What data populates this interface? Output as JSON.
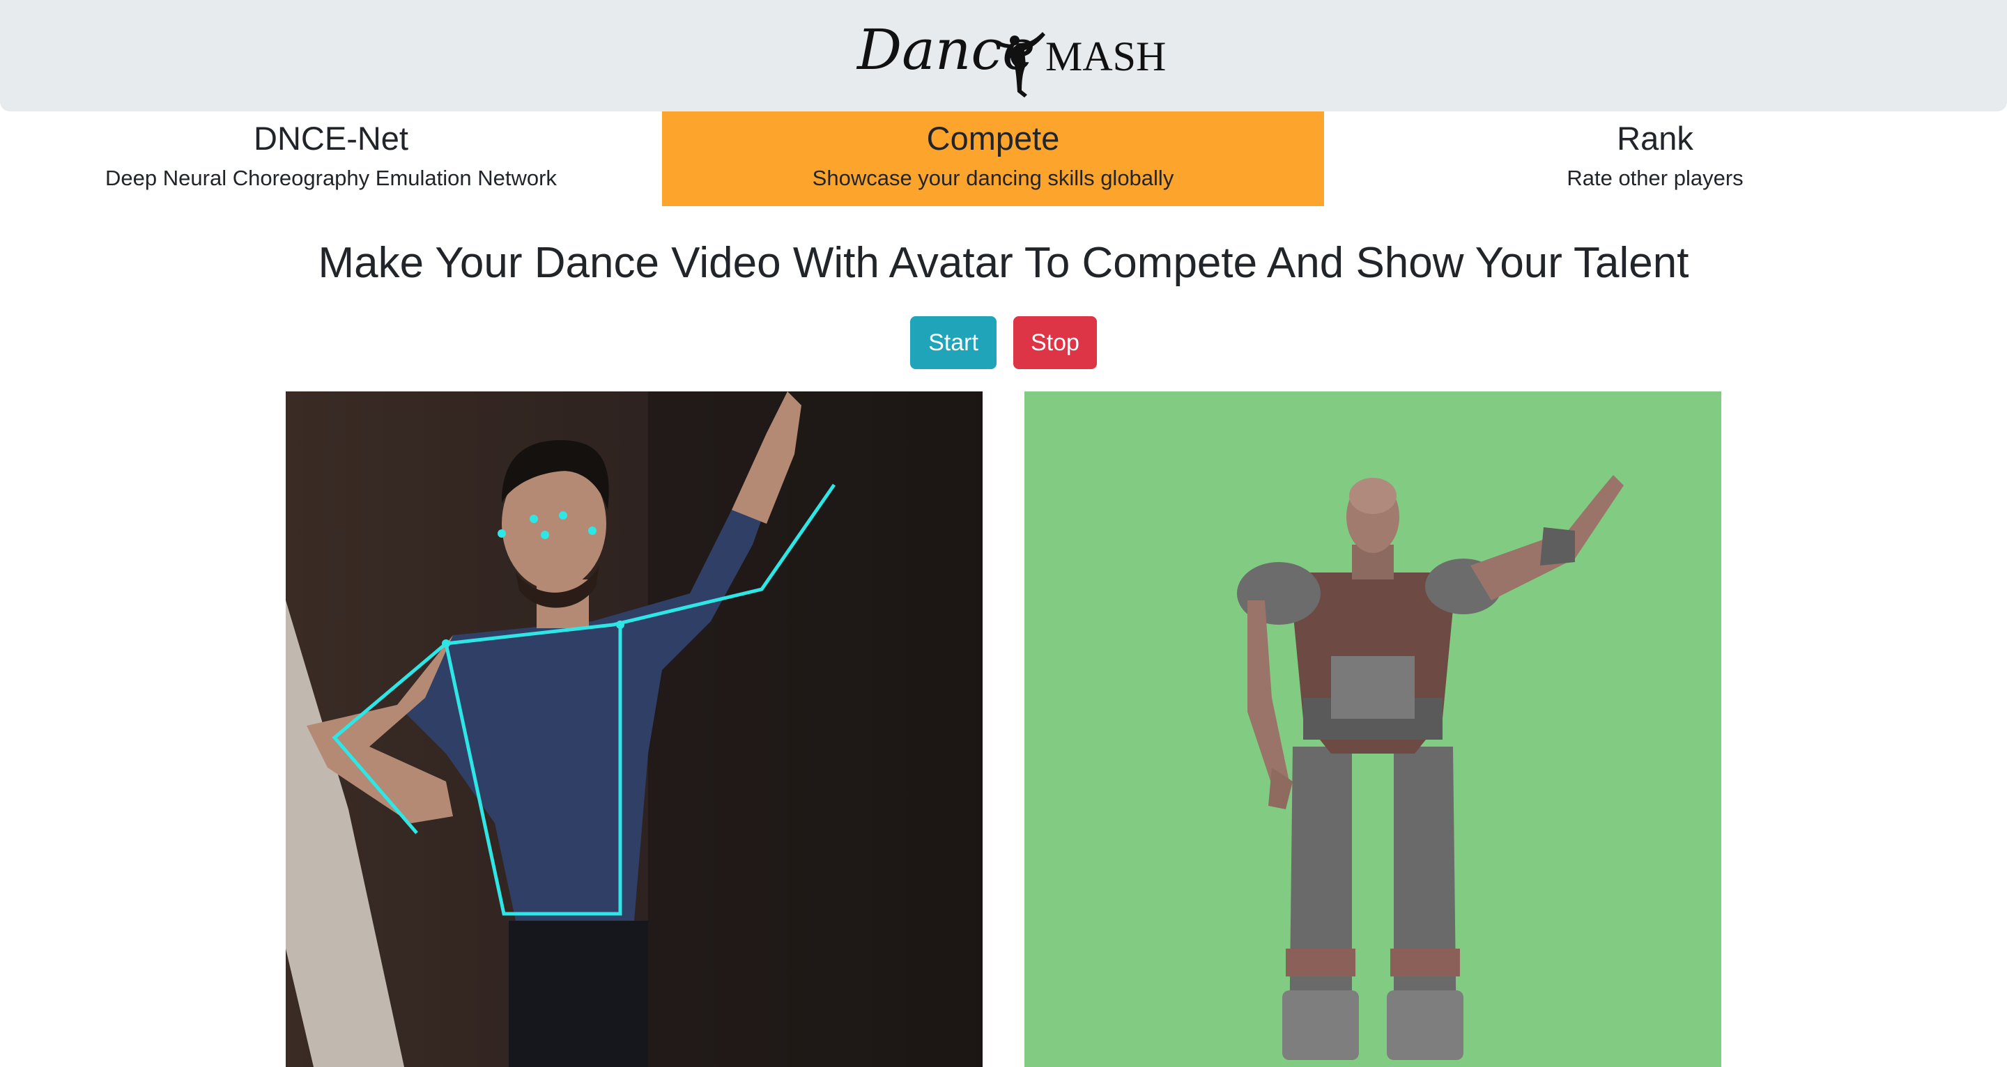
{
  "header": {
    "logo": {
      "word1": "Dance",
      "word2": "MASH"
    }
  },
  "nav": [
    {
      "title": "DNCE-Net",
      "subtitle": "Deep Neural Choreography Emulation Network",
      "active": false
    },
    {
      "title": "Compete",
      "subtitle": "Showcase your dancing skills globally",
      "active": true
    },
    {
      "title": "Rank",
      "subtitle": "Rate other players",
      "active": false
    }
  ],
  "main": {
    "headline": "Make Your Dance Video With Avatar To Compete And Show Your Talent",
    "start_label": "Start",
    "stop_label": "Stop"
  },
  "colors": {
    "header_bg": "#e8ebee",
    "active_tab": "#fca42c",
    "start_button": "#20a4ba",
    "stop_button": "#dd3446",
    "skeleton": "#2ee6e6",
    "avatar_bg": "#82cb82"
  },
  "icons": {
    "logo_figure": "dancer-silhouette-icon"
  }
}
